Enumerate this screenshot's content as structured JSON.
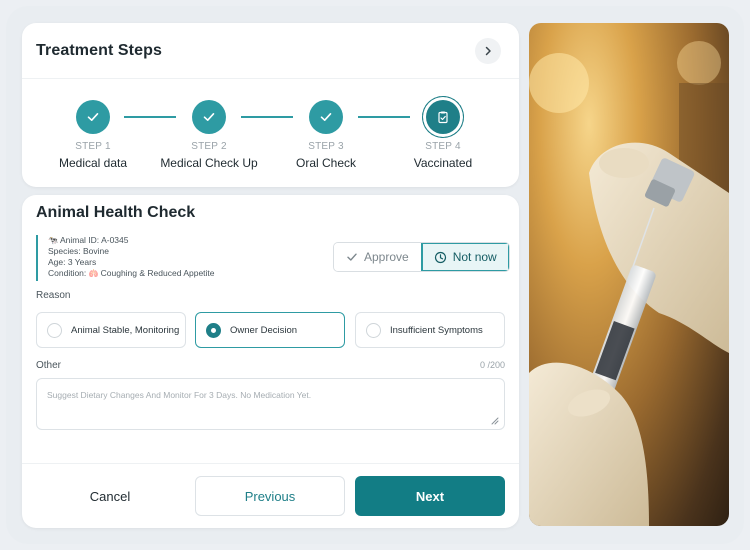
{
  "steps_card": {
    "title": "Treatment Steps",
    "steps": [
      {
        "number": "STEP 1",
        "name": "Medical data",
        "status": "complete"
      },
      {
        "number": "STEP 2",
        "name": "Medical Check Up",
        "status": "complete"
      },
      {
        "number": "STEP 3",
        "name": "Oral Check",
        "status": "complete"
      },
      {
        "number": "STEP 4",
        "name": "Vaccinated",
        "status": "current"
      }
    ]
  },
  "health_card": {
    "title": "Animal Health Check",
    "info": {
      "animal_id": "Animal ID: A-0345",
      "species": "Species: Bovine",
      "age": "Age: 3 Years",
      "condition_label": "Condition:",
      "condition_value": "Coughing & Reduced Appetite"
    },
    "decision": {
      "approve": "Approve",
      "not_now": "Not now",
      "selected": "not_now"
    },
    "reason_label": "Reason",
    "reasons": [
      {
        "label": "Animal Stable, Monitoring",
        "selected": false
      },
      {
        "label": "Owner Decision",
        "selected": true
      },
      {
        "label": "Insufficient Symptoms",
        "selected": false
      }
    ],
    "other_label": "Other",
    "other_counter": "0 /200",
    "other_placeholder": "Suggest Dietary Changes And Monitor For 3 Days. No Medication Yet."
  },
  "footer": {
    "cancel": "Cancel",
    "previous": "Previous",
    "next": "Next"
  },
  "colors": {
    "accent": "#2e9ba3",
    "accent_dark": "#127d85",
    "background": "#eceff3"
  }
}
